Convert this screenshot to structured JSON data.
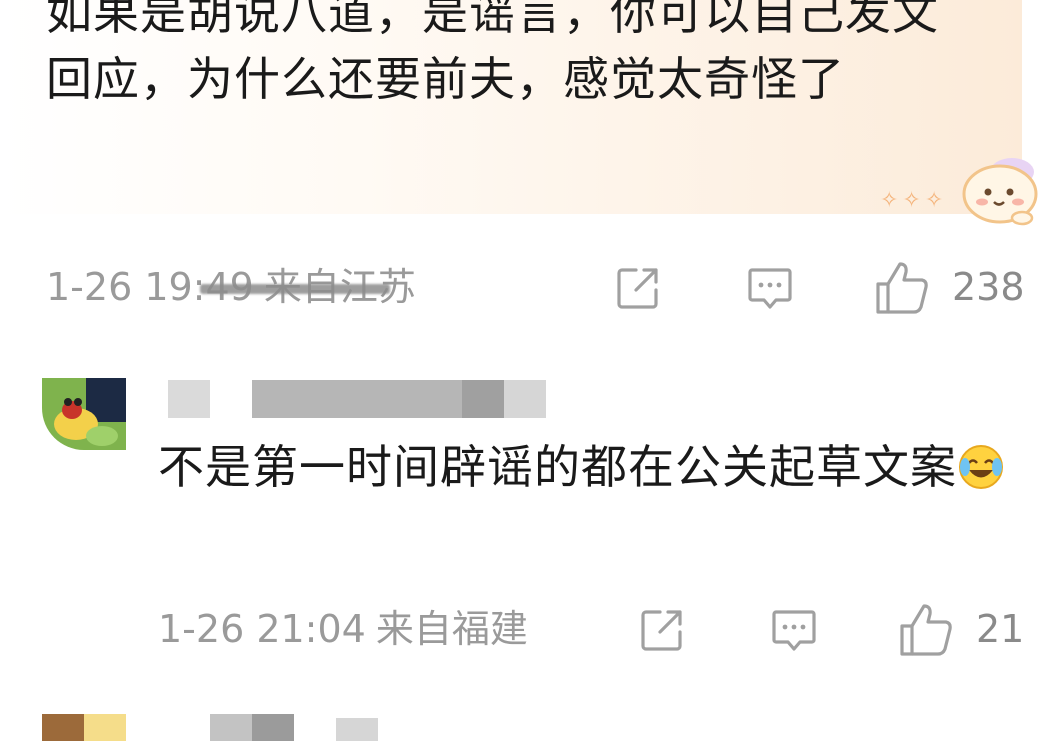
{
  "comments": [
    {
      "text": "如果是胡说八道，是谣言，你可以自己发文回应，为什么还要前夫，感觉太奇怪了",
      "time": "1-26 19:49",
      "location": "来自江苏",
      "likes": "238",
      "highlighted": true
    },
    {
      "text": "不是第一时间辟谣的都在公关起草文案",
      "emoji": "laughing-crying-emoji",
      "time": "1-26 21:04",
      "location": "来自福建",
      "likes": "21",
      "highlighted": false
    }
  ],
  "colors": {
    "text": "#1a1a1a",
    "meta": "#9a9a9a",
    "icon": "#a0a0a0",
    "bubble": "#fdf1e4"
  },
  "icons": {
    "share": "share-icon",
    "reply": "comment-icon",
    "like": "thumbs-up-icon"
  }
}
